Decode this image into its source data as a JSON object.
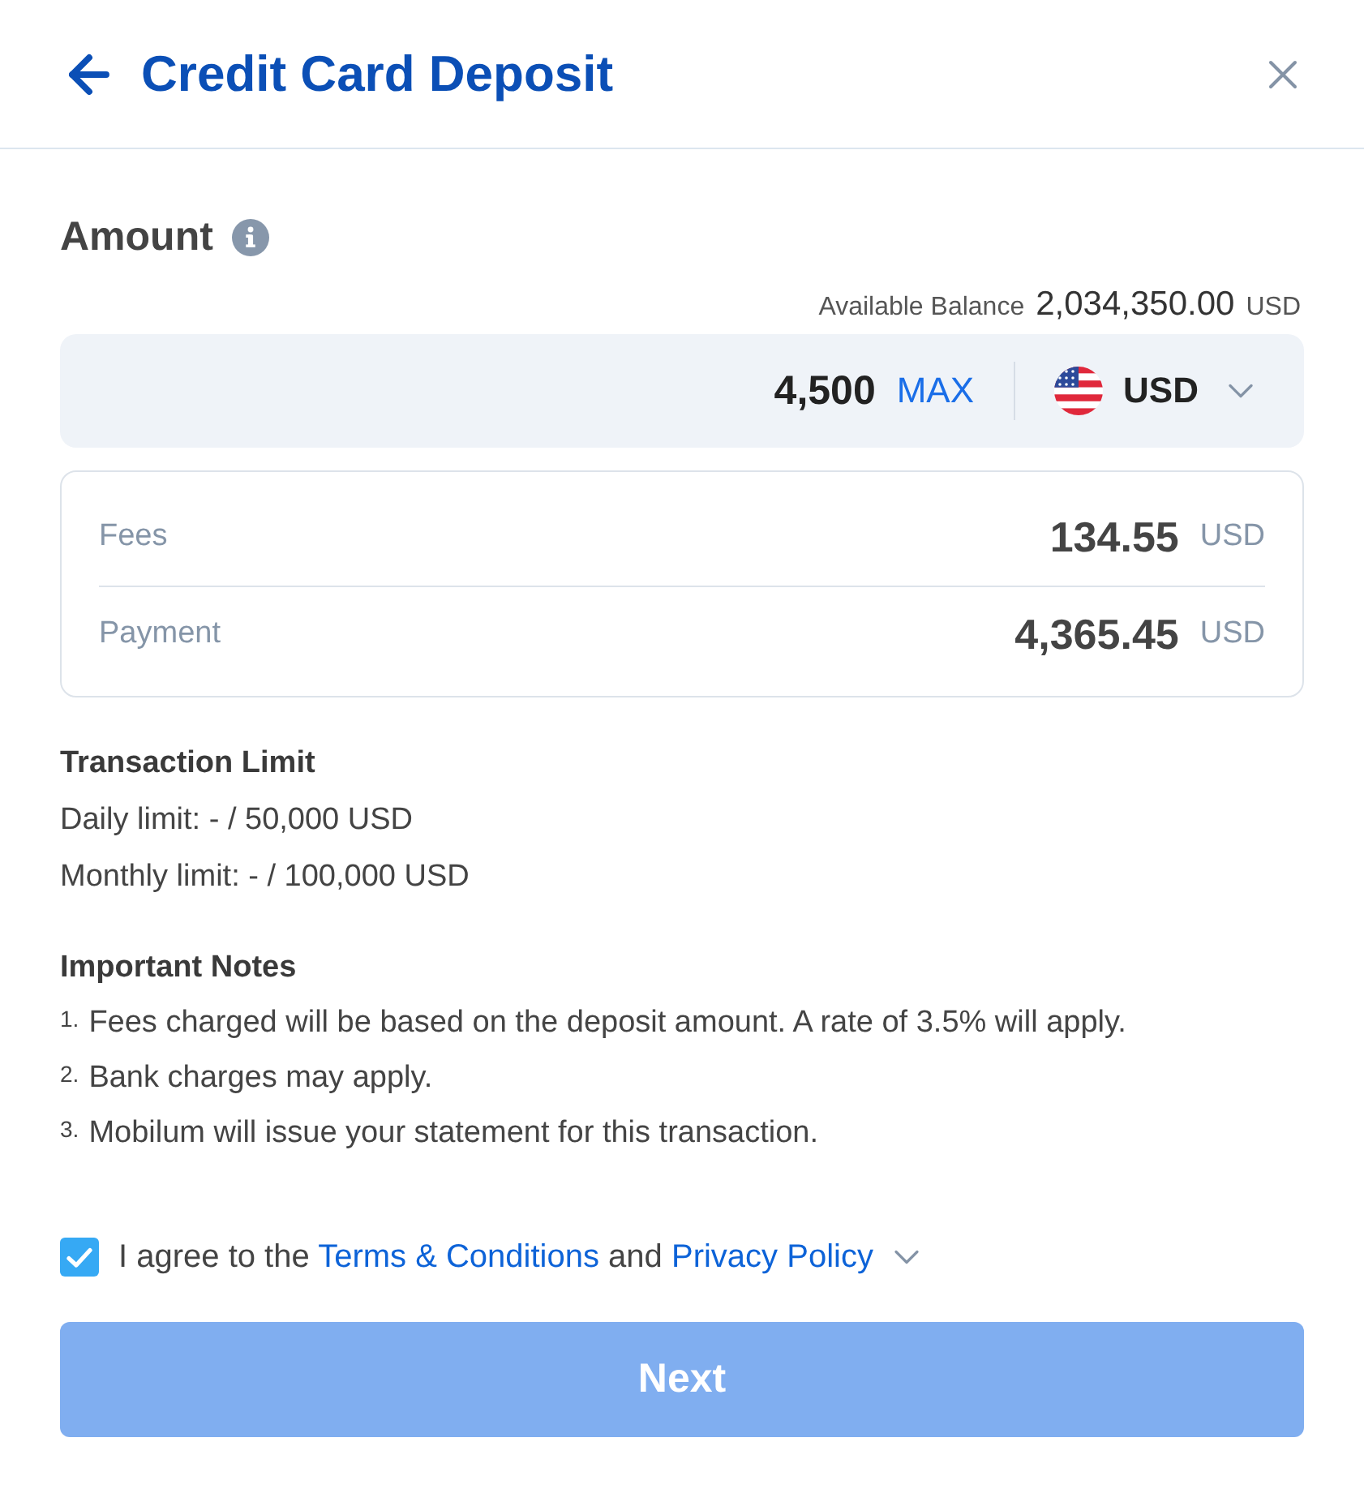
{
  "header": {
    "title": "Credit Card Deposit"
  },
  "amount": {
    "label": "Amount",
    "balance_label": "Available Balance",
    "balance_value": "2,034,350.00",
    "balance_currency": "USD",
    "value": "4,500",
    "max_label": "MAX",
    "currency": "USD"
  },
  "summary": [
    {
      "label": "Fees",
      "value": "134.55",
      "currency": "USD"
    },
    {
      "label": "Payment",
      "value": "4,365.45",
      "currency": "USD"
    }
  ],
  "transaction_limit": {
    "title": "Transaction Limit",
    "lines": [
      "Daily limit: - / 50,000 USD",
      "Monthly limit: - / 100,000 USD"
    ]
  },
  "notes": {
    "title": "Important Notes",
    "items": [
      {
        "marker": "1.",
        "text": "Fees charged will be based on the deposit amount. A rate of 3.5% will apply."
      },
      {
        "marker": "2.",
        "text": "Bank charges may apply."
      },
      {
        "marker": "3.",
        "text": "Mobilum will issue your statement for this transaction."
      }
    ]
  },
  "agreement": {
    "checked": true,
    "text_before": "I agree to the",
    "terms_link": "Terms & Conditions",
    "text_middle": "and",
    "privacy_link": "Privacy Policy"
  },
  "next_button": {
    "label": "Next",
    "disabled": true
  }
}
